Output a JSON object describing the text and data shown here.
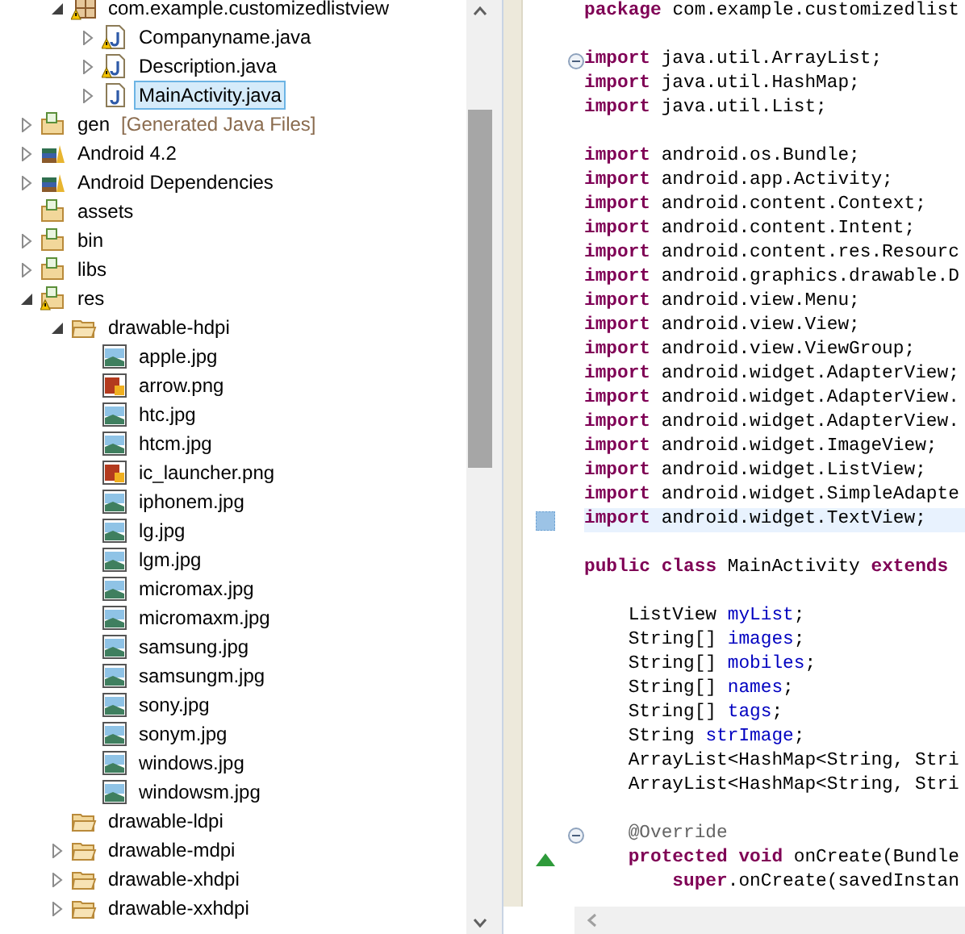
{
  "tree": {
    "continued_children": [
      {
        "kind": "package",
        "label": "com.example.customizedlistview",
        "expanded": true,
        "warning": true,
        "selected": false,
        "children": [
          {
            "kind": "java",
            "label": "Companyname.java",
            "expanded": false,
            "warning": true,
            "selected": false
          },
          {
            "kind": "java",
            "label": "Description.java",
            "expanded": false,
            "warning": true,
            "selected": false
          },
          {
            "kind": "java",
            "label": "MainActivity.java",
            "expanded": false,
            "warning": false,
            "selected": true
          }
        ]
      }
    ],
    "items": [
      {
        "kind": "gen",
        "label": "gen",
        "decoration": "[Generated Java Files]",
        "expanded": false,
        "warning": false,
        "selected": false
      },
      {
        "kind": "library",
        "label": "Android 4.2",
        "expanded": false,
        "warning": false,
        "selected": false
      },
      {
        "kind": "library",
        "label": "Android Dependencies",
        "expanded": false,
        "warning": false,
        "selected": false
      },
      {
        "kind": "source-folder",
        "label": "assets",
        "warning": false,
        "selected": false
      },
      {
        "kind": "source-folder",
        "label": "bin",
        "expanded": false,
        "warning": false,
        "selected": false
      },
      {
        "kind": "source-folder",
        "label": "libs",
        "expanded": false,
        "warning": false,
        "selected": false
      },
      {
        "kind": "source-folder",
        "label": "res",
        "expanded": true,
        "warning": true,
        "selected": false,
        "children": [
          {
            "kind": "folder",
            "label": "drawable-hdpi",
            "expanded": true,
            "warning": false,
            "selected": false,
            "children": [
              {
                "kind": "image",
                "label": "apple.jpg",
                "warning": false,
                "selected": false
              },
              {
                "kind": "png",
                "label": "arrow.png",
                "warning": false,
                "selected": false
              },
              {
                "kind": "image",
                "label": "htc.jpg",
                "warning": false,
                "selected": false
              },
              {
                "kind": "image",
                "label": "htcm.jpg",
                "warning": false,
                "selected": false
              },
              {
                "kind": "png",
                "label": "ic_launcher.png",
                "warning": false,
                "selected": false
              },
              {
                "kind": "image",
                "label": "iphonem.jpg",
                "warning": false,
                "selected": false
              },
              {
                "kind": "image",
                "label": "lg.jpg",
                "warning": false,
                "selected": false
              },
              {
                "kind": "image",
                "label": "lgm.jpg",
                "warning": false,
                "selected": false
              },
              {
                "kind": "image",
                "label": "micromax.jpg",
                "warning": false,
                "selected": false
              },
              {
                "kind": "image",
                "label": "micromaxm.jpg",
                "warning": false,
                "selected": false
              },
              {
                "kind": "image",
                "label": "samsung.jpg",
                "warning": false,
                "selected": false
              },
              {
                "kind": "image",
                "label": "samsungm.jpg",
                "warning": false,
                "selected": false
              },
              {
                "kind": "image",
                "label": "sony.jpg",
                "warning": false,
                "selected": false
              },
              {
                "kind": "image",
                "label": "sonym.jpg",
                "warning": false,
                "selected": false
              },
              {
                "kind": "image",
                "label": "windows.jpg",
                "warning": false,
                "selected": false
              },
              {
                "kind": "image",
                "label": "windowsm.jpg",
                "warning": false,
                "selected": false
              }
            ]
          },
          {
            "kind": "folder",
            "label": "drawable-ldpi",
            "warning": false,
            "selected": false
          },
          {
            "kind": "folder",
            "label": "drawable-mdpi",
            "expanded": false,
            "warning": false,
            "selected": false
          },
          {
            "kind": "folder",
            "label": "drawable-xhdpi",
            "expanded": false,
            "warning": false,
            "selected": false
          },
          {
            "kind": "folder",
            "label": "drawable-xxhdpi",
            "expanded": false,
            "warning": false,
            "selected": false
          }
        ]
      }
    ]
  },
  "editor": {
    "lines": [
      {
        "kind": "code",
        "tokens": [
          {
            "kind": "keyword",
            "text": "package"
          },
          {
            "kind": "plain",
            "text": " com.example.customizedlist"
          }
        ]
      },
      {
        "kind": "blank"
      },
      {
        "kind": "code",
        "fold": true,
        "tokens": [
          {
            "kind": "keyword",
            "text": "import"
          },
          {
            "kind": "plain",
            "text": " java.util.ArrayList;"
          }
        ]
      },
      {
        "kind": "code",
        "tokens": [
          {
            "kind": "keyword",
            "text": "import"
          },
          {
            "kind": "plain",
            "text": " java.util.HashMap;"
          }
        ]
      },
      {
        "kind": "code",
        "tokens": [
          {
            "kind": "keyword",
            "text": "import"
          },
          {
            "kind": "plain",
            "text": " java.util.List;"
          }
        ]
      },
      {
        "kind": "blank"
      },
      {
        "kind": "code",
        "tokens": [
          {
            "kind": "keyword",
            "text": "import"
          },
          {
            "kind": "plain",
            "text": " android.os.Bundle;"
          }
        ]
      },
      {
        "kind": "code",
        "tokens": [
          {
            "kind": "keyword",
            "text": "import"
          },
          {
            "kind": "plain",
            "text": " android.app.Activity;"
          }
        ]
      },
      {
        "kind": "code",
        "tokens": [
          {
            "kind": "keyword",
            "text": "import"
          },
          {
            "kind": "plain",
            "text": " android.content.Context;"
          }
        ]
      },
      {
        "kind": "code",
        "tokens": [
          {
            "kind": "keyword",
            "text": "import"
          },
          {
            "kind": "plain",
            "text": " android.content.Intent;"
          }
        ]
      },
      {
        "kind": "code",
        "tokens": [
          {
            "kind": "keyword",
            "text": "import"
          },
          {
            "kind": "plain",
            "text": " android.content.res.Resourc"
          }
        ]
      },
      {
        "kind": "code",
        "tokens": [
          {
            "kind": "keyword",
            "text": "import"
          },
          {
            "kind": "plain",
            "text": " android.graphics.drawable.D"
          }
        ]
      },
      {
        "kind": "code",
        "tokens": [
          {
            "kind": "keyword",
            "text": "import"
          },
          {
            "kind": "plain",
            "text": " android.view.Menu;"
          }
        ]
      },
      {
        "kind": "code",
        "tokens": [
          {
            "kind": "keyword",
            "text": "import"
          },
          {
            "kind": "plain",
            "text": " android.view.View;"
          }
        ]
      },
      {
        "kind": "code",
        "tokens": [
          {
            "kind": "keyword",
            "text": "import"
          },
          {
            "kind": "plain",
            "text": " android.view.ViewGroup;"
          }
        ]
      },
      {
        "kind": "code",
        "tokens": [
          {
            "kind": "keyword",
            "text": "import"
          },
          {
            "kind": "plain",
            "text": " android.widget.AdapterView;"
          }
        ]
      },
      {
        "kind": "code",
        "tokens": [
          {
            "kind": "keyword",
            "text": "import"
          },
          {
            "kind": "plain",
            "text": " android.widget.AdapterView."
          }
        ]
      },
      {
        "kind": "code",
        "tokens": [
          {
            "kind": "keyword",
            "text": "import"
          },
          {
            "kind": "plain",
            "text": " android.widget.AdapterView."
          }
        ]
      },
      {
        "kind": "code",
        "tokens": [
          {
            "kind": "keyword",
            "text": "import"
          },
          {
            "kind": "plain",
            "text": " android.widget.ImageView;"
          }
        ]
      },
      {
        "kind": "code",
        "tokens": [
          {
            "kind": "keyword",
            "text": "import"
          },
          {
            "kind": "plain",
            "text": " android.widget.ListView;"
          }
        ]
      },
      {
        "kind": "code",
        "tokens": [
          {
            "kind": "keyword",
            "text": "import"
          },
          {
            "kind": "plain",
            "text": " android.widget.SimpleAdapte"
          }
        ]
      },
      {
        "kind": "code",
        "current": true,
        "occurrence": true,
        "tokens": [
          {
            "kind": "keyword",
            "text": "import"
          },
          {
            "kind": "plain",
            "text": " android.widget.TextView;"
          }
        ]
      },
      {
        "kind": "blank"
      },
      {
        "kind": "code",
        "tokens": [
          {
            "kind": "keyword",
            "text": "public"
          },
          {
            "kind": "keyword",
            "text": " class"
          },
          {
            "kind": "plain",
            "text": " MainActivity "
          },
          {
            "kind": "keyword",
            "text": "extends"
          }
        ],
        "children": [
          {
            "kind": "blank"
          },
          {
            "kind": "code",
            "tokens": [
              {
                "kind": "plain",
                "text": "ListView "
              },
              {
                "kind": "field",
                "text": "myList"
              },
              {
                "kind": "plain",
                "text": ";"
              }
            ]
          },
          {
            "kind": "code",
            "tokens": [
              {
                "kind": "plain",
                "text": "String[] "
              },
              {
                "kind": "field",
                "text": "images"
              },
              {
                "kind": "plain",
                "text": ";"
              }
            ]
          },
          {
            "kind": "code",
            "tokens": [
              {
                "kind": "plain",
                "text": "String[] "
              },
              {
                "kind": "field",
                "text": "mobiles"
              },
              {
                "kind": "plain",
                "text": ";"
              }
            ]
          },
          {
            "kind": "code",
            "tokens": [
              {
                "kind": "plain",
                "text": "String[] "
              },
              {
                "kind": "field",
                "text": "names"
              },
              {
                "kind": "plain",
                "text": ";"
              }
            ]
          },
          {
            "kind": "code",
            "tokens": [
              {
                "kind": "plain",
                "text": "String[] "
              },
              {
                "kind": "field",
                "text": "tags"
              },
              {
                "kind": "plain",
                "text": ";"
              }
            ]
          },
          {
            "kind": "code",
            "tokens": [
              {
                "kind": "plain",
                "text": "String "
              },
              {
                "kind": "field",
                "text": "strImage"
              },
              {
                "kind": "plain",
                "text": ";"
              }
            ]
          },
          {
            "kind": "code",
            "tokens": [
              {
                "kind": "plain",
                "text": "ArrayList<HashMap<String, Stri"
              }
            ]
          },
          {
            "kind": "code",
            "tokens": [
              {
                "kind": "plain",
                "text": "ArrayList<HashMap<String, Stri"
              }
            ]
          },
          {
            "kind": "blank"
          },
          {
            "kind": "code",
            "fold": true,
            "tokens": [
              {
                "kind": "annotation",
                "text": "@Override"
              }
            ]
          },
          {
            "kind": "code",
            "override": true,
            "tokens": [
              {
                "kind": "keyword",
                "text": "protected"
              },
              {
                "kind": "keyword",
                "text": " void"
              },
              {
                "kind": "plain",
                "text": " onCreate(Bundle"
              }
            ],
            "children": [
              {
                "kind": "code",
                "tokens": [
                  {
                    "kind": "keyword",
                    "text": "super"
                  },
                  {
                    "kind": "plain",
                    "text": ".onCreate(savedInstan"
                  }
                ]
              }
            ]
          }
        ]
      }
    ]
  }
}
